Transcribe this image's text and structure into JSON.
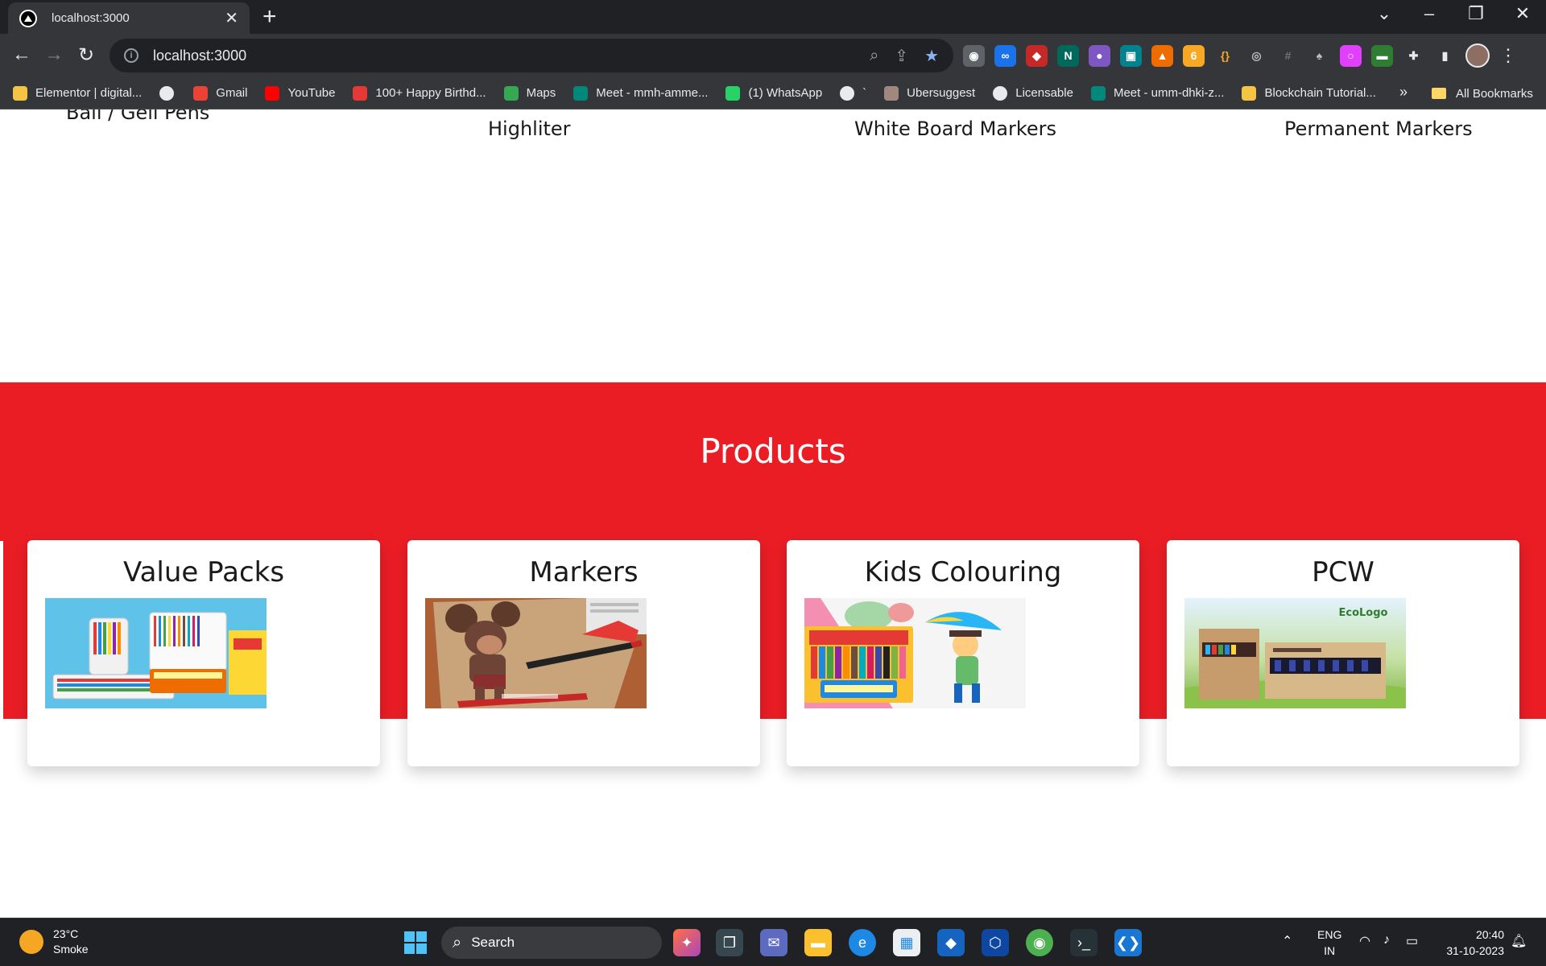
{
  "browser": {
    "tab_title": "localhost:3000",
    "url": "localhost:3000",
    "bookmarks": [
      {
        "label": "Elementor | digital...",
        "color": "#f4c542"
      },
      {
        "label": "",
        "color": "#e8eaed"
      },
      {
        "label": "Gmail",
        "color": "#ea4335"
      },
      {
        "label": "YouTube",
        "color": "#ff0000"
      },
      {
        "label": "100+ Happy Birthd...",
        "color": "#e53935"
      },
      {
        "label": "Maps",
        "color": "#34a853"
      },
      {
        "label": "Meet - mmh-amme...",
        "color": "#00897b"
      },
      {
        "label": "(1) WhatsApp",
        "color": "#25d366"
      },
      {
        "label": "`",
        "color": "#e8eaed"
      },
      {
        "label": "Ubersuggest",
        "color": "#a1887f"
      },
      {
        "label": "Licensable",
        "color": "#e8eaed"
      },
      {
        "label": "Meet - umm-dhki-z...",
        "color": "#00897b"
      },
      {
        "label": "Blockchain Tutorial...",
        "color": "#f4c542"
      }
    ],
    "all_bookmarks": "All Bookmarks"
  },
  "page": {
    "categories": [
      "Ball / Gell Pens",
      "Highliter",
      "White Board Markers",
      "Permanent Markers"
    ],
    "products_title": "Products",
    "products": [
      {
        "title": "Value Packs"
      },
      {
        "title": "Markers"
      },
      {
        "title": "Kids Colouring"
      },
      {
        "title": "PCW"
      }
    ],
    "pcw_logo_text": "EcoLogo",
    "accent_color": "#ea1d25"
  },
  "taskbar": {
    "temperature": "23°C",
    "weather": "Smoke",
    "search": "Search",
    "lang_1": "ENG",
    "lang_2": "IN",
    "time": "20:40",
    "date": "31-10-2023"
  }
}
